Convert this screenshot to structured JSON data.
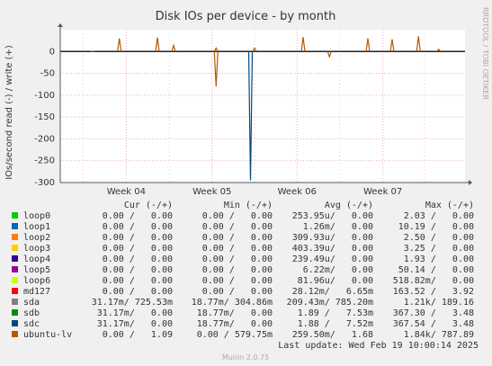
{
  "chart_data": {
    "type": "line",
    "title": "Disk IOs per device - by month",
    "ylabel": "IOs/second read (-) / write (+)",
    "side_label": "RRDTOOL / TOBI OETIKER",
    "ylim": [
      -300,
      50
    ],
    "y_ticks": [
      0,
      -50,
      -100,
      -150,
      -200,
      -250,
      -300
    ],
    "x_ticks": [
      "Week 04",
      "Week 05",
      "Week 06",
      "Week 07"
    ],
    "grid": true,
    "table_header": {
      "cur": "Cur (-/+)",
      "min": "Min (-/+)",
      "avg": "Avg (-/+)",
      "max": "Max (-/+)"
    },
    "series": [
      {
        "name": "loop0",
        "color": "#00cc00",
        "cur": "0.00 /   0.00",
        "min": "0.00 /   0.00",
        "avg": "253.95u/   0.00",
        "max": "2.03 /   0.00"
      },
      {
        "name": "loop1",
        "color": "#0066b3",
        "cur": "0.00 /   0.00",
        "min": "0.00 /   0.00",
        "avg": "1.26m/   0.00",
        "max": "10.19 /   0.00"
      },
      {
        "name": "loop2",
        "color": "#ff8000",
        "cur": "0.00 /   0.00",
        "min": "0.00 /   0.00",
        "avg": "309.93u/   0.00",
        "max": "2.50 /   0.00"
      },
      {
        "name": "loop3",
        "color": "#ffcc00",
        "cur": "0.00 /   0.00",
        "min": "0.00 /   0.00",
        "avg": "403.39u/   0.00",
        "max": "3.25 /   0.00"
      },
      {
        "name": "loop4",
        "color": "#330099",
        "cur": "0.00 /   0.00",
        "min": "0.00 /   0.00",
        "avg": "239.49u/   0.00",
        "max": "1.93 /   0.00"
      },
      {
        "name": "loop5",
        "color": "#990099",
        "cur": "0.00 /   0.00",
        "min": "0.00 /   0.00",
        "avg": "6.22m/   0.00",
        "max": "50.14 /   0.00"
      },
      {
        "name": "loop6",
        "color": "#ccff00",
        "cur": "0.00 /   0.00",
        "min": "0.00 /   0.00",
        "avg": "81.96u/   0.00",
        "max": "518.82m/   0.00"
      },
      {
        "name": "md127",
        "color": "#ff0000",
        "cur": "0.00 /   0.00",
        "min": "0.00 /   0.00",
        "avg": "28.12m/   6.65m",
        "max": "163.52 /   3.92"
      },
      {
        "name": "sda",
        "color": "#808080",
        "cur": "31.17m/ 725.53m",
        "min": "18.77m/ 304.86m",
        "avg": "209.43m/ 785.20m",
        "max": "1.21k/ 189.16"
      },
      {
        "name": "sdb",
        "color": "#008f00",
        "cur": "31.17m/   0.00",
        "min": "18.77m/   0.00",
        "avg": "1.89 /   7.53m",
        "max": "367.30 /   3.48"
      },
      {
        "name": "sdc",
        "color": "#00487d",
        "cur": "31.17m/   0.00",
        "min": "18.77m/   0.00",
        "avg": "1.88 /   7.52m",
        "max": "367.54 /   3.48"
      },
      {
        "name": "ubuntu-lv",
        "color": "#b35a00",
        "cur": "0.00 /   1.09",
        "min": "0.00 / 579.75m",
        "avg": "259.50m/   1.68",
        "max": "1.84k/ 787.89"
      }
    ],
    "spikes": [
      {
        "x": 0.08,
        "y": 1,
        "color": "#b35a00"
      },
      {
        "x": 0.146,
        "y": 30,
        "color": "#b35a00"
      },
      {
        "x": 0.24,
        "y": 32,
        "color": "#b35a00"
      },
      {
        "x": 0.28,
        "y": 14,
        "color": "#b35a00"
      },
      {
        "x": 0.385,
        "y": 8,
        "color": "#b35a00"
      },
      {
        "x": 0.385,
        "y": -80,
        "color": "#b35a00"
      },
      {
        "x": 0.47,
        "y": -295,
        "color": "#00487d"
      },
      {
        "x": 0.48,
        "y": 8,
        "color": "#b35a00"
      },
      {
        "x": 0.6,
        "y": 33,
        "color": "#b35a00"
      },
      {
        "x": 0.665,
        "y": -12,
        "color": "#b35a00"
      },
      {
        "x": 0.76,
        "y": 30,
        "color": "#b35a00"
      },
      {
        "x": 0.82,
        "y": 28,
        "color": "#b35a00"
      },
      {
        "x": 0.885,
        "y": 35,
        "color": "#b35a00"
      },
      {
        "x": 0.935,
        "y": 5,
        "color": "#b35a00"
      }
    ],
    "last_update": "Last update: Wed Feb 19 10:00:14 2025",
    "footer": "Munin 2.0.75"
  }
}
